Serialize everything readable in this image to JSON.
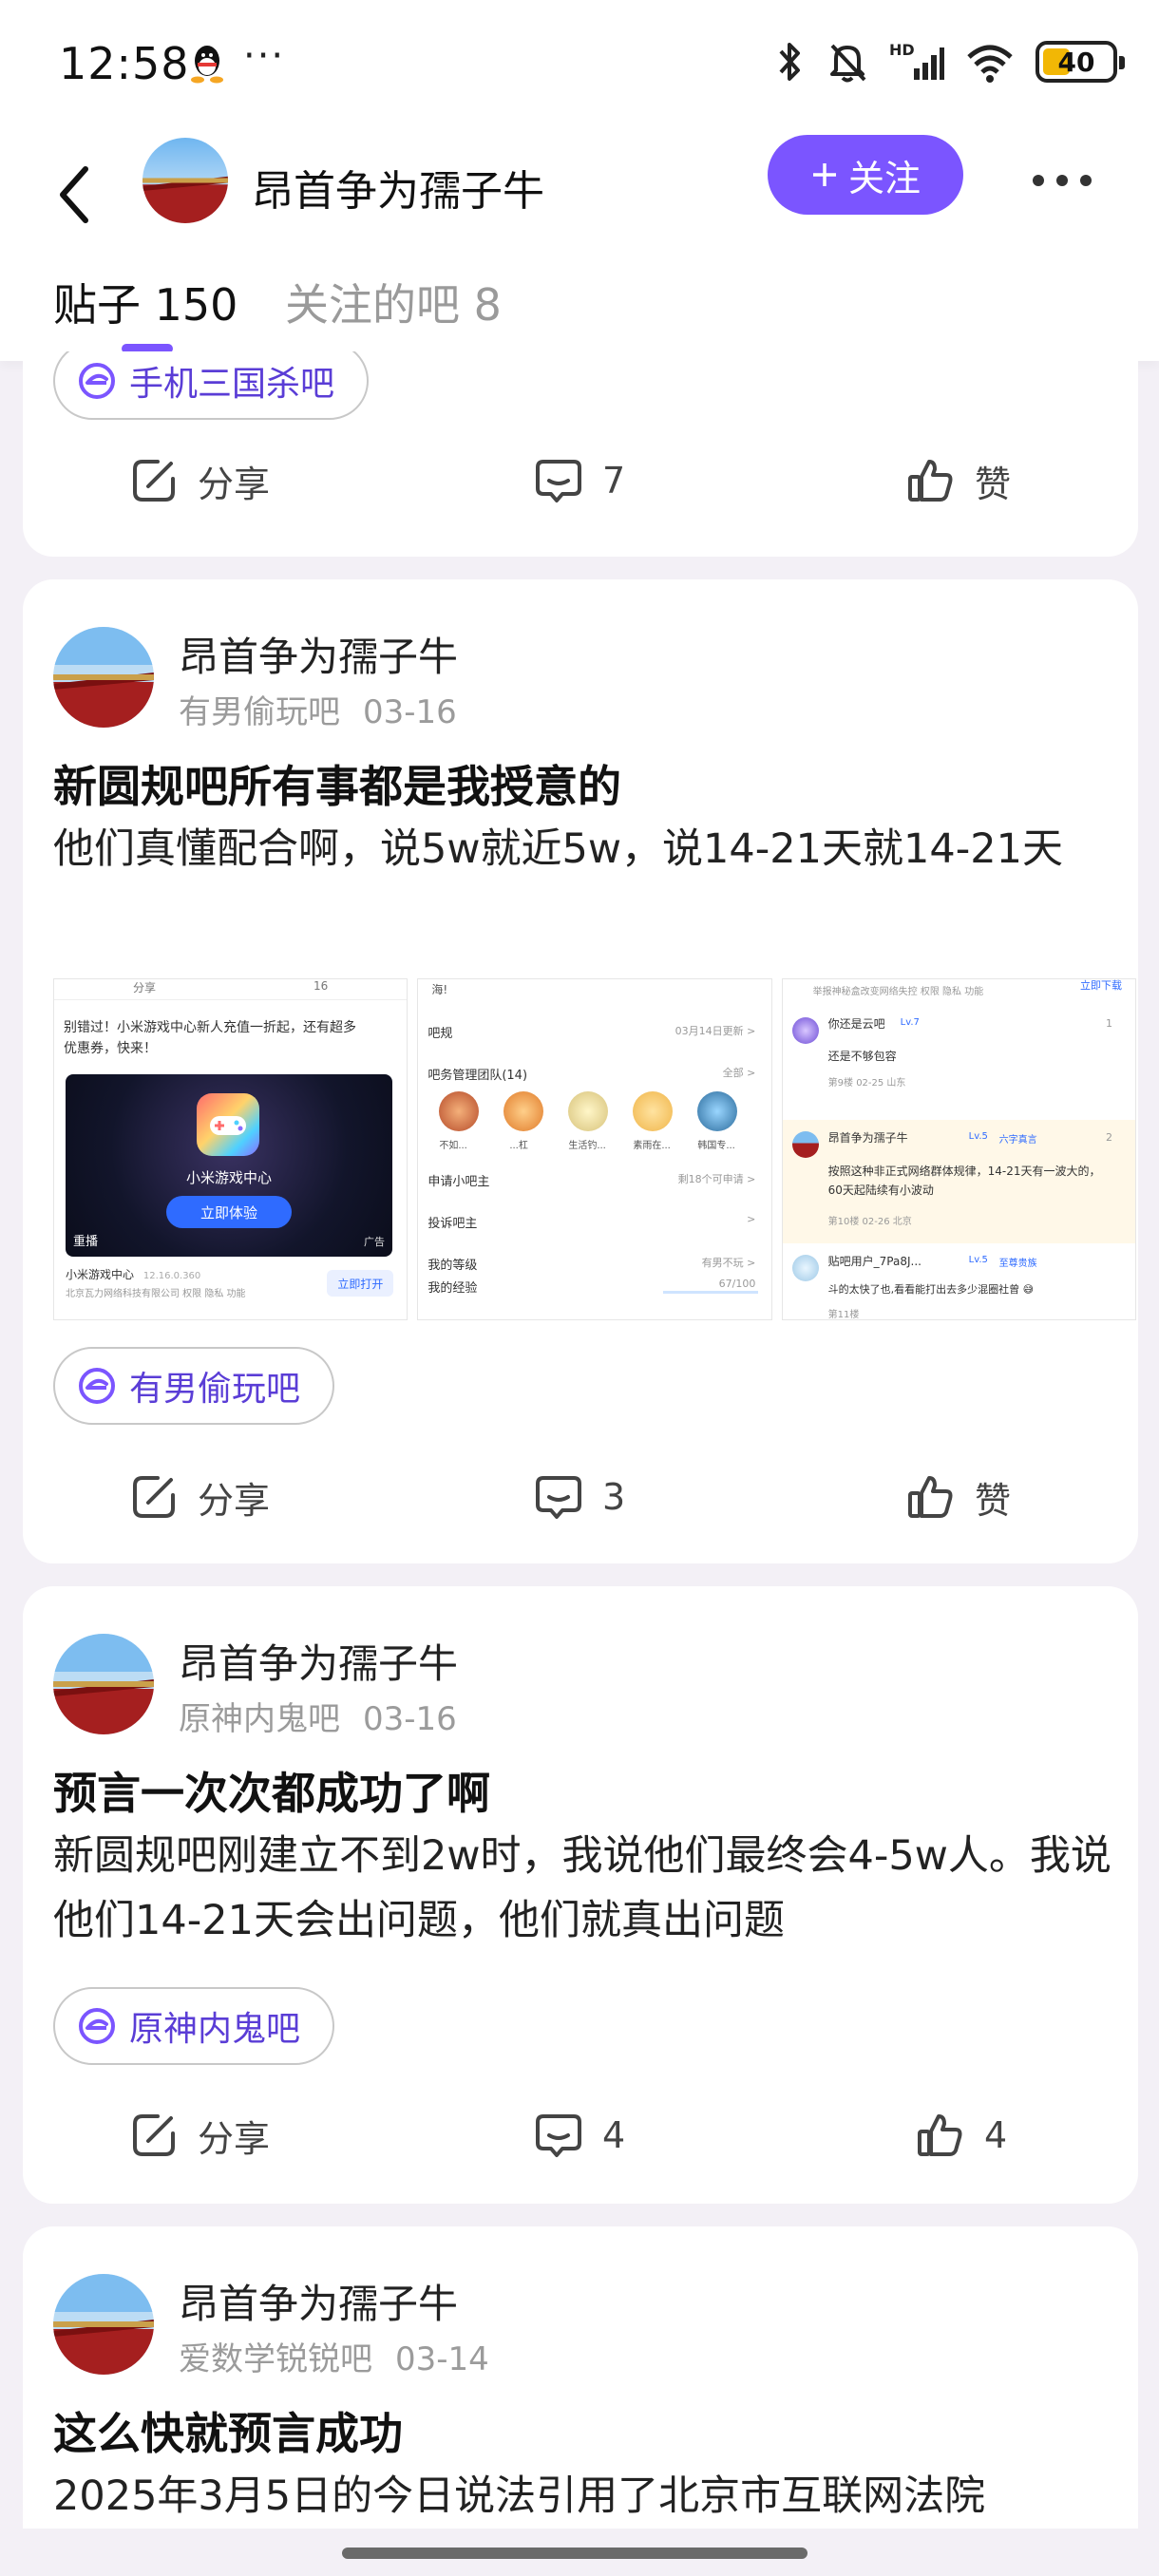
{
  "status_bar": {
    "time": "12:58",
    "more": "···",
    "battery": "40",
    "network": "HD"
  },
  "header": {
    "username": "昂首争为孺子牛",
    "follow_label": "关注",
    "tabs": [
      {
        "label": "贴子 150",
        "active": true
      },
      {
        "label": "关注的吧 8",
        "active": false
      }
    ]
  },
  "labels": {
    "share": "分享",
    "like": "赞"
  },
  "posts": [
    {
      "forum": "手机三国杀吧",
      "comments": "7",
      "likes": "赞"
    },
    {
      "author": "昂首争为孺子牛",
      "forum_name": "有男偷玩吧",
      "date": "03-16",
      "title": "新圆规吧所有事都是我授意的",
      "body": "他们真懂配合啊，说5w就近5w，说14-21天就14-21天",
      "forum": "有男偷玩吧",
      "comments": "3",
      "likes": "赞",
      "images": {
        "img1": {
          "tab_left": "分享",
          "tab_right": "16",
          "banner": "别错过！小米游戏中心新人充值一折起，还有超多优惠券，快来！",
          "game_name": "小米游戏中心",
          "try_btn": "立即体验",
          "replay": "重播",
          "ad": "广告",
          "app_name": "小米游戏中心",
          "app_version": "12.16.0.360",
          "company": "北京瓦力网络科技有限公司  权限  隐私  功能",
          "open_btn": "立即打开"
        },
        "img2": {
          "top": "海!",
          "rows": [
            {
              "left": "吧规",
              "right": "03月14日更新 >"
            },
            {
              "left": "吧务管理团队(14)",
              "right": "全部 >"
            },
            {
              "left": "申请小吧主",
              "right": "剩18个可申请 >"
            },
            {
              "left": "投诉吧主",
              "right": ">"
            },
            {
              "left": "我的等级",
              "right": "有男不玩 >"
            },
            {
              "left": "我的经验",
              "right": "67/100"
            }
          ],
          "members": [
            "不如...",
            "...杠",
            "生活钓...",
            "素雨在...",
            "韩国专..."
          ]
        },
        "img3": {
          "top_text": "举报神秘盒改变网络失控    权限  隐私  功能",
          "top_btn": "立即下载",
          "c1_name": "你还是云吧",
          "c1_level": "Lv.7",
          "c1_text": "还是不够包容",
          "c1_meta": "第9楼  02-25  山东",
          "c1_likes": "1",
          "c2_name": "昂首争为孺子牛",
          "c2_level": "Lv.5",
          "c2_badge": "六字真言",
          "c2_text": "按照这种非正式网络群体规律，14-21天有一波大的，60天起陆续有小波动",
          "c2_meta": "第10楼  02-26  北京",
          "c2_likes": "2",
          "c3_name": "贴吧用户_7Pa8J...",
          "c3_level": "Lv.5",
          "c3_badge": "至尊贵族",
          "c3_text": "斗的太快了也,看看能打出去多少混圈社曾 😅",
          "c3_meta": "第11楼"
        }
      }
    },
    {
      "author": "昂首争为孺子牛",
      "forum_name": "原神内鬼吧",
      "date": "03-16",
      "title": "预言一次次都成功了啊",
      "body": "新圆规吧刚建立不到2w时，我说他们最终会4-5w人。我说他们14-21天会出问题，他们就真出问题",
      "forum": "原神内鬼吧",
      "comments": "4",
      "likes": "4"
    },
    {
      "author": "昂首争为孺子牛",
      "forum_name": "爱数学锐锐吧",
      "date": "03-14",
      "title": "这么快就预言成功",
      "body": "2025年3月5日的今日说法引用了北京市互联网法院"
    }
  ],
  "colors": {
    "accent": "#7b55ff",
    "forum_chip_text": "#5a3dd6",
    "background": "#f3f0f6"
  }
}
